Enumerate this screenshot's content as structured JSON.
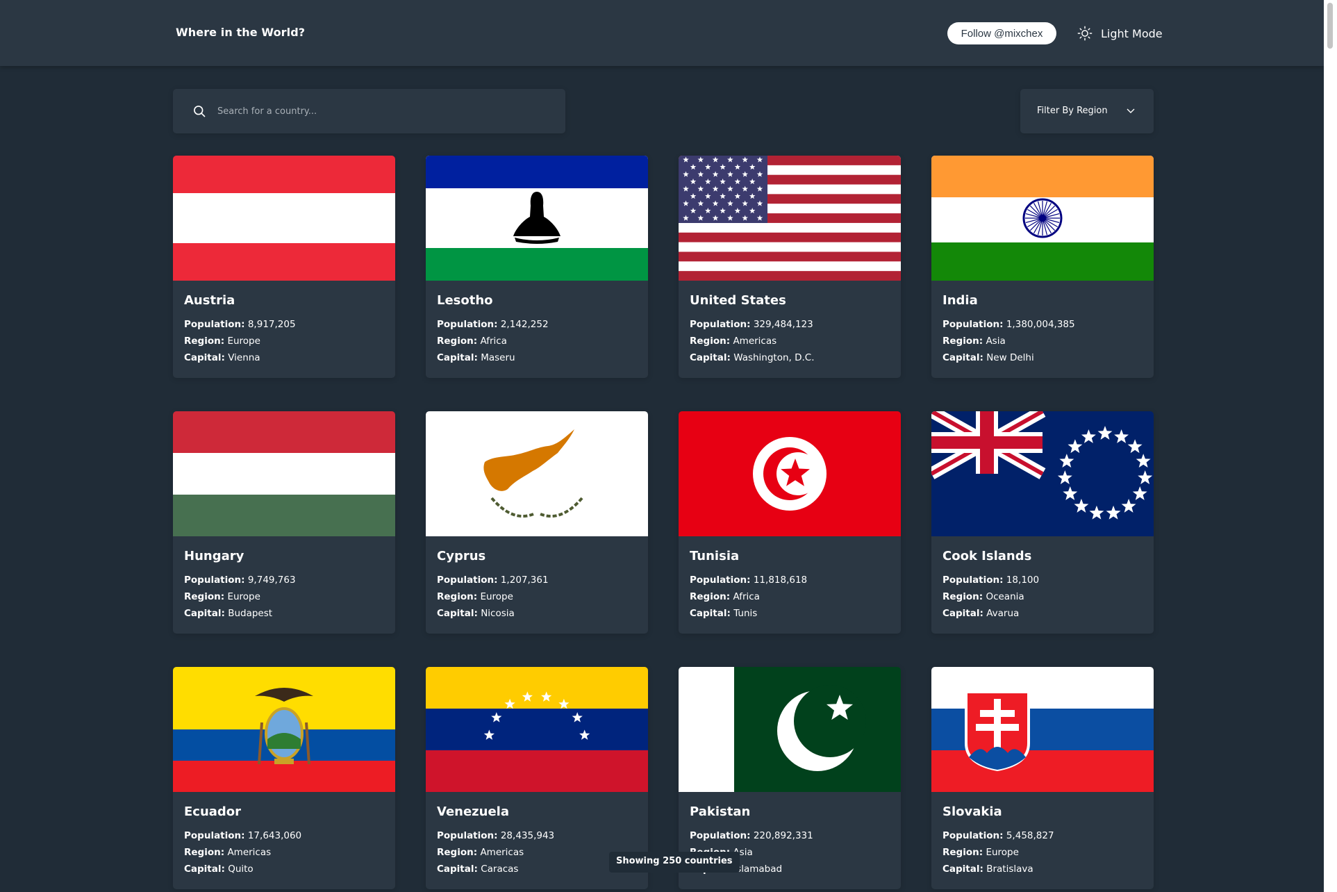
{
  "header": {
    "title": "Where in the World?",
    "follow_label": "Follow @mixchex",
    "mode_label": "Light Mode"
  },
  "search": {
    "placeholder": "Search for a country..."
  },
  "filter": {
    "label": "Filter By Region"
  },
  "stat_labels": {
    "population": "Population:",
    "region": "Region:",
    "capital": "Capital:"
  },
  "countries": [
    {
      "name": "Austria",
      "population": "8,917,205",
      "region": "Europe",
      "capital": "Vienna",
      "flag": "austria"
    },
    {
      "name": "Lesotho",
      "population": "2,142,252",
      "region": "Africa",
      "capital": "Maseru",
      "flag": "lesotho"
    },
    {
      "name": "United States",
      "population": "329,484,123",
      "region": "Americas",
      "capital": "Washington, D.C.",
      "flag": "usa"
    },
    {
      "name": "India",
      "population": "1,380,004,385",
      "region": "Asia",
      "capital": "New Delhi",
      "flag": "india"
    },
    {
      "name": "Hungary",
      "population": "9,749,763",
      "region": "Europe",
      "capital": "Budapest",
      "flag": "hungary"
    },
    {
      "name": "Cyprus",
      "population": "1,207,361",
      "region": "Europe",
      "capital": "Nicosia",
      "flag": "cyprus"
    },
    {
      "name": "Tunisia",
      "population": "11,818,618",
      "region": "Africa",
      "capital": "Tunis",
      "flag": "tunisia"
    },
    {
      "name": "Cook Islands",
      "population": "18,100",
      "region": "Oceania",
      "capital": "Avarua",
      "flag": "cook-islands"
    },
    {
      "name": "Ecuador",
      "population": "17,643,060",
      "region": "Americas",
      "capital": "Quito",
      "flag": "ecuador"
    },
    {
      "name": "Venezuela",
      "population": "28,435,943",
      "region": "Americas",
      "capital": "Caracas",
      "flag": "venezuela"
    },
    {
      "name": "Pakistan",
      "population": "220,892,331",
      "region": "Asia",
      "capital": "Islamabad",
      "flag": "pakistan"
    },
    {
      "name": "Slovakia",
      "population": "5,458,827",
      "region": "Europe",
      "capital": "Bratislava",
      "flag": "slovakia"
    }
  ],
  "toast": "Showing 250 countries",
  "colors": {
    "background": "#202c37",
    "surface": "#2b3743",
    "text": "#ffffff"
  }
}
